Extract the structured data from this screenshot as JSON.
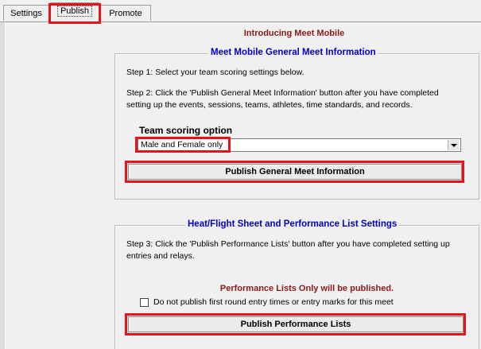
{
  "tabs": [
    {
      "label": "Settings"
    },
    {
      "label": "Publish"
    },
    {
      "label": "Promote"
    }
  ],
  "intro_title": "Introducing Meet Mobile",
  "general": {
    "legend": "Meet Mobile General Meet Information",
    "step1": "Step 1:  Select your team scoring settings below.",
    "step2_line1": "Step 2:  Click the 'Publish General Meet Information' button after you have completed",
    "step2_line2": "setting up the events, sessions, teams, athletes, time standards, and records.",
    "scoring_label": "Team scoring option",
    "scoring_value": "Male and Female only",
    "publish_button": "Publish General Meet Information"
  },
  "heat": {
    "legend": "Heat/Flight Sheet and Performance List Settings",
    "step3_line1": "Step 3:  Click the 'Publish Performance Lists' button after you have completed setting up",
    "step3_line2": "entries and relays.",
    "notice": "Performance Lists Only will be published.",
    "checkbox_label": "Do not publish first round entry times or entry marks for this meet",
    "publish_button": "Publish Performance Lists"
  },
  "colors": {
    "highlight": "#e5141b",
    "legend_text": "#0000cc",
    "notice_text": "#8b1a1a"
  }
}
